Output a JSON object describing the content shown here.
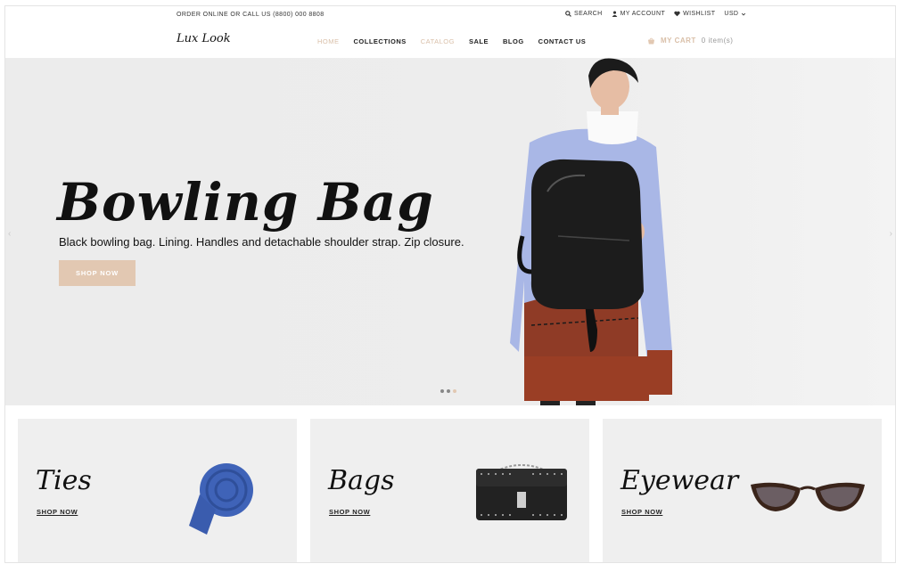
{
  "topbar": {
    "contact": "ORDER ONLINE OR CALL US (8800) 000 8808",
    "search": "SEARCH",
    "account": "MY ACCOUNT",
    "wishlist": "WISHLIST",
    "currency": "USD"
  },
  "header": {
    "logo": "Lux Look",
    "nav": [
      "HOME",
      "COLLECTIONS",
      "CATALOG",
      "SALE",
      "BLOG",
      "CONTACT US"
    ],
    "cart_label": "MY CART",
    "cart_count": "0 item(s)"
  },
  "hero": {
    "title": "Bowling Bag",
    "description": "Black bowling bag. Lining. Handles and detachable shoulder strap. Zip closure.",
    "button": "SHOP NOW",
    "slides_total": 3,
    "active_slide": 3
  },
  "categories": [
    {
      "title": "Ties",
      "link": "SHOP NOW"
    },
    {
      "title": "Bags",
      "link": "SHOP NOW"
    },
    {
      "title": "Eyewear",
      "link": "SHOP NOW"
    }
  ],
  "icons": {
    "search": "search-icon",
    "account": "user-icon",
    "wishlist": "heart-icon",
    "currency_dropdown": "chevron-down-icon",
    "cart": "cart-icon",
    "prev": "chevron-left-icon",
    "next": "chevron-right-icon"
  },
  "colors": {
    "accent": "#e2c8b2",
    "hero_bg": "#ececec",
    "card_bg": "#efefef"
  }
}
